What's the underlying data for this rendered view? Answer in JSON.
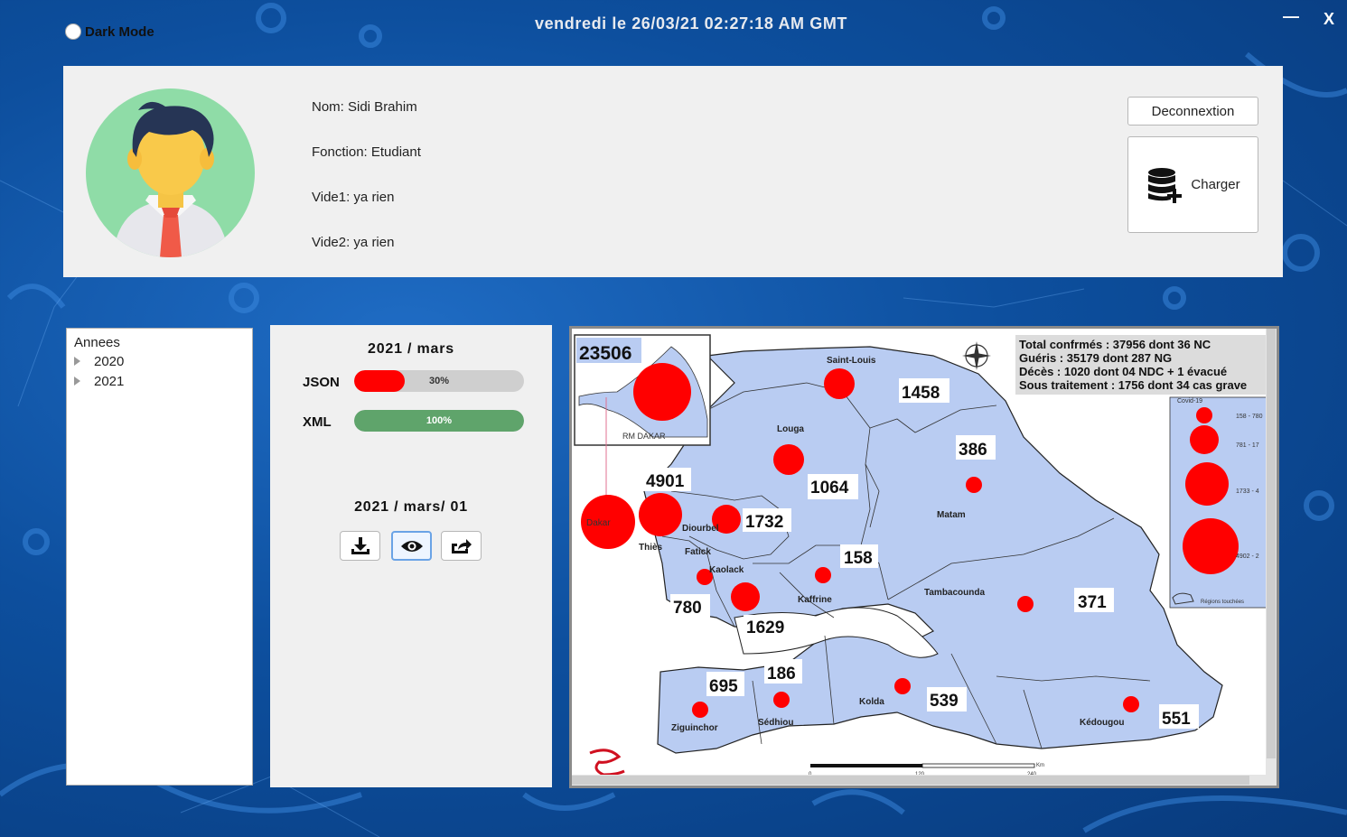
{
  "header": {
    "dark_mode_label": "Dark Mode",
    "datetime": "vendredi  le 26/03/21  02:27:18 AM GMT",
    "minimize": "—",
    "close": "X"
  },
  "profile": {
    "nom": "Nom: Sidi Brahim",
    "fonction": "Fonction: Etudiant",
    "vide1": "Vide1: ya rien",
    "vide2": "Vide2: ya rien",
    "deconnexion_label": "Deconnextion",
    "charger_label": "Charger",
    "charger_icon": "database-add-icon"
  },
  "tree": {
    "root": "Annees",
    "items": [
      "2020",
      "2021"
    ]
  },
  "progress": {
    "title": "2021 / mars",
    "json_label": "JSON",
    "json_value": 30,
    "json_text": "30%",
    "json_color": "#ff0000",
    "xml_label": "XML",
    "xml_value": 100,
    "xml_text": "100%",
    "xml_color": "#5fa46b",
    "day_title": "2021 / mars/ 01",
    "buttons": [
      "download-icon",
      "eye-icon",
      "export-icon"
    ]
  },
  "map": {
    "inset_value": "23506",
    "inset_label": "RM DAKAR",
    "stats": [
      "Total confrmés : 37956 dont 36 NC",
      "Guéris : 35179 dont 287 NG",
      "Décès : 1020 dont 04 NDC + 1 évacué",
      "Sous traitement : 1756 dont 34 cas grave"
    ],
    "legend_title": "Covid-19",
    "legend_ranges": [
      "158 - 780",
      "781 - 17",
      "1733 - 4",
      "4902 - 2"
    ],
    "legend_footer": "Régions touchées",
    "regions": [
      {
        "name": "Dakar",
        "value": ""
      },
      {
        "name": "Thiès",
        "value": "4901"
      },
      {
        "name": "Diourbel",
        "value": "1732"
      },
      {
        "name": "Fatick",
        "value": "780"
      },
      {
        "name": "Kaolack",
        "value": "1629"
      },
      {
        "name": "Kaffrine",
        "value": "158"
      },
      {
        "name": "Louga",
        "value": "1064"
      },
      {
        "name": "Saint-Louis",
        "value": "1458"
      },
      {
        "name": "Matam",
        "value": "386"
      },
      {
        "name": "Tambacounda",
        "value": "371"
      },
      {
        "name": "Ziguinchor",
        "value": "695"
      },
      {
        "name": "Sédhiou",
        "value": "186"
      },
      {
        "name": "Kolda",
        "value": "539"
      },
      {
        "name": "Kédougou",
        "value": "551"
      }
    ],
    "scale": {
      "unit": "Km",
      "ticks": [
        "0",
        "120",
        "240"
      ]
    }
  }
}
